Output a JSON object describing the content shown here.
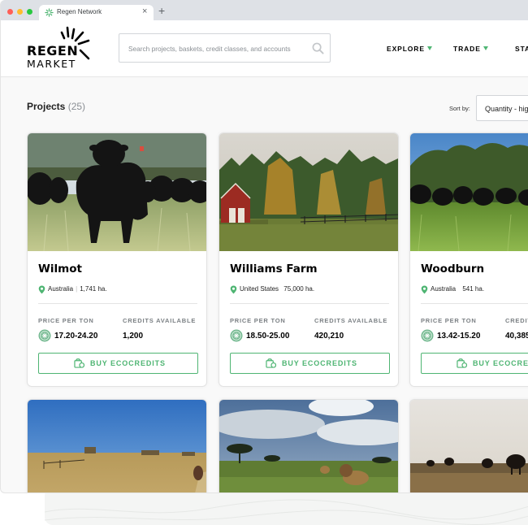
{
  "browser": {
    "tab_title": "Regen Network",
    "tab_close": "×",
    "new_tab": "+"
  },
  "header": {
    "logo_regen": "REGEN",
    "logo_market": "MARKET",
    "search_placeholder": "Search projects, baskets, credit classes, and accounts",
    "nav": [
      "EXPLORE",
      "TRADE",
      "STA"
    ]
  },
  "main": {
    "title": "Projects",
    "count": "(25)",
    "sort_by_label": "Sort by:",
    "sort_value": "Quantity - hig"
  },
  "labels": {
    "price": "PRICE PER TON",
    "credits": "CREDITS AVAILABLE",
    "buy": "BUY ECOCREDITS"
  },
  "cards": [
    {
      "name": "Wilmot",
      "location": "Australia",
      "area": "1,741 ha.",
      "price": "17.20-24.20",
      "credits": "1,200"
    },
    {
      "name": "Williams Farm",
      "location": "United States",
      "area": "75,000 ha.",
      "price": "18.50-25.00",
      "credits": "420,210"
    },
    {
      "name": "Woodburn",
      "location": "Australia",
      "area": "541 ha.",
      "price": "13.42-15.20",
      "credits": "40,385"
    }
  ],
  "colors": {
    "accent": "#4fb573",
    "text": "#000000",
    "muted": "#7b8084"
  },
  "icons": [
    "search-icon",
    "location-pin-icon",
    "regen-coin-icon",
    "ecocredit-icon",
    "chevron-down-icon"
  ]
}
